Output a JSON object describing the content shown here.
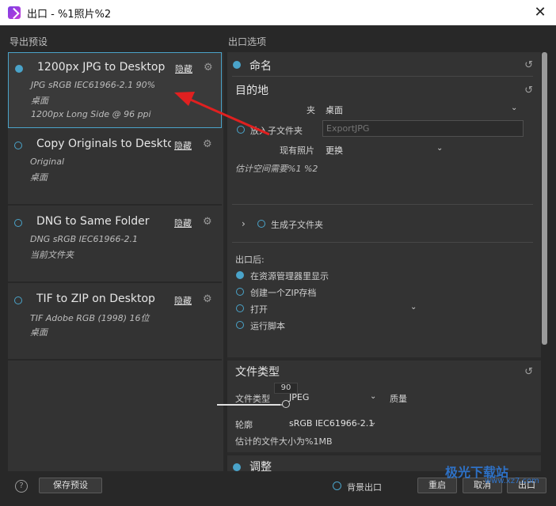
{
  "window": {
    "title": "出口 - %1照片%2",
    "close_symbol": "✕"
  },
  "left_panel": {
    "header": "导出预设",
    "presets": [
      {
        "name": "1200px JPG to Desktop",
        "hide": "隐藏",
        "details": [
          "JPG  sRGB IEC61966-2.1  90%",
          "桌面",
          "1200px Long Side @ 96 ppi"
        ],
        "selected": true
      },
      {
        "name": "Copy Originals to Desktop",
        "hide": "隐藏",
        "details": [
          "Original",
          "桌面"
        ],
        "selected": false
      },
      {
        "name": "DNG to Same Folder",
        "hide": "隐藏",
        "details": [
          "DNG  sRGB IEC61966-2.1",
          "当前文件夹"
        ],
        "selected": false
      },
      {
        "name": "TIF to ZIP on Desktop",
        "hide": "隐藏",
        "details": [
          "TIF  Adobe RGB (1998)  16位",
          "桌面"
        ],
        "selected": false
      }
    ]
  },
  "right_panel": {
    "header": "出口选项",
    "naming": {
      "title": "命名"
    },
    "destination": {
      "title": "目的地",
      "folder_label": "夹",
      "folder_value": "桌面",
      "subfolder_label": "放入子文件夹",
      "subfolder_placeholder": "ExportJPG",
      "existing_label": "现有照片",
      "existing_value": "更换",
      "estimate": "估计空间需要%1 %2",
      "generate_subfolder": "生成子文件夹"
    },
    "after_export": {
      "title": "出口后:",
      "options": [
        "在资源管理器里显示",
        "创建一个ZIP存档",
        "打开",
        "运行脚本"
      ]
    },
    "file_type": {
      "title": "文件类型",
      "type_label": "文件类型",
      "type_value": "JPEG",
      "quality_label": "质量",
      "quality_value": "90",
      "profile_label": "轮廓",
      "profile_value": "sRGB IEC61966-2.1",
      "estimate": "估计的文件大小为%1MB"
    },
    "adjust": {
      "title": "调整"
    }
  },
  "bottom_bar": {
    "help": "?",
    "save_preset": "保存预设",
    "background_export": "背景出口",
    "reset": "重启",
    "cancel": "取消",
    "export": "出口"
  },
  "watermark": {
    "main": "极光下载站",
    "sub": "www.xz7.com"
  },
  "colors": {
    "accent": "#4aa3c9",
    "annotation": "#e02020"
  }
}
